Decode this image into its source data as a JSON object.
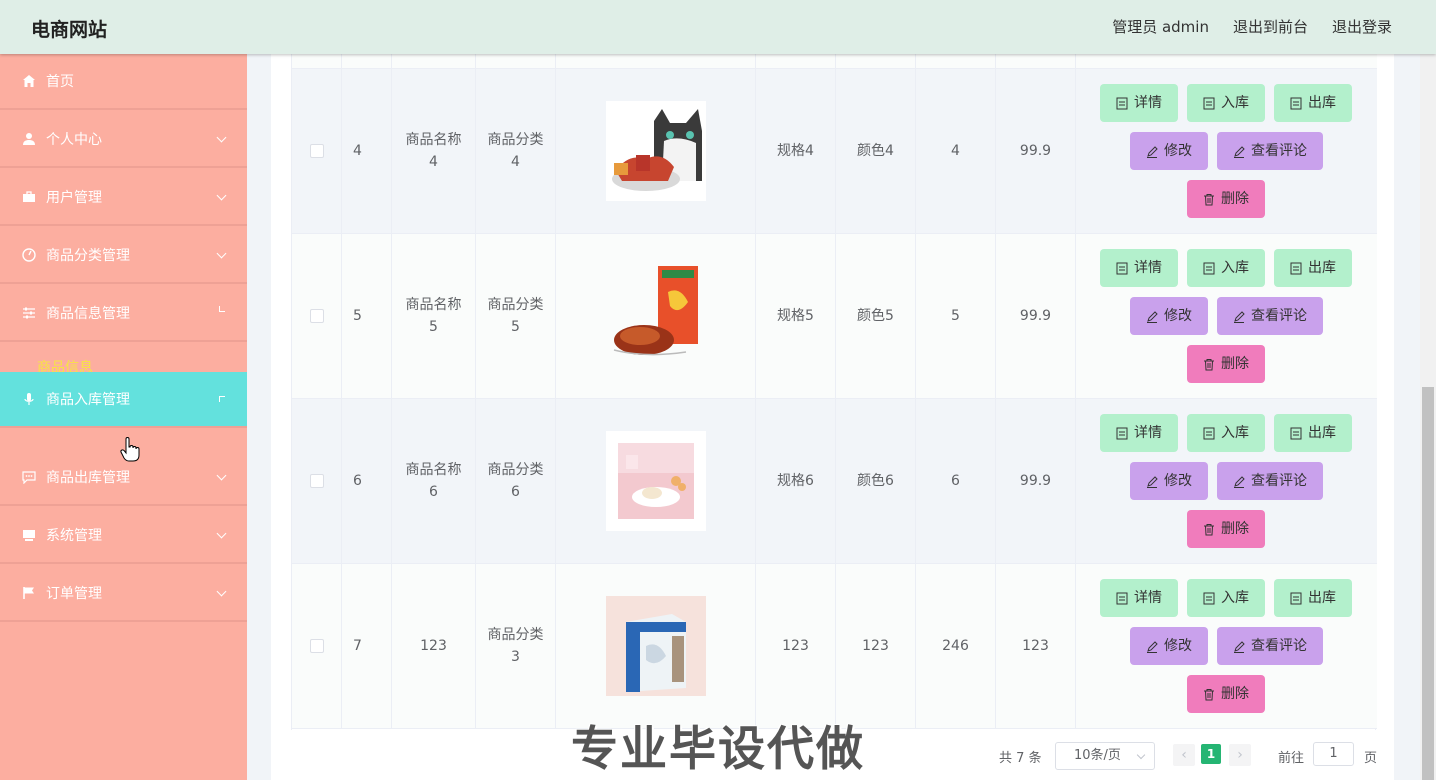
{
  "header": {
    "brand": "电商网站",
    "links": [
      "管理员 admin",
      "退出到前台",
      "退出登录"
    ]
  },
  "sidebar": {
    "items": [
      {
        "label": "首页",
        "icon": "home-icon"
      },
      {
        "label": "个人中心",
        "icon": "user-icon"
      },
      {
        "label": "用户管理",
        "icon": "briefcase-icon"
      },
      {
        "label": "商品分类管理",
        "icon": "gauge-icon"
      },
      {
        "label": "商品信息管理",
        "icon": "sliders-icon"
      },
      {
        "label": "商品入库管理",
        "icon": "mic-icon"
      },
      {
        "label": "商品出库管理",
        "icon": "chat-icon"
      },
      {
        "label": "系统管理",
        "icon": "monitor-icon"
      },
      {
        "label": "订单管理",
        "icon": "flag-icon"
      }
    ],
    "submenu_label": "商品信息"
  },
  "table": {
    "rows": [
      {
        "index": "4",
        "name": "商品名称4",
        "category": "商品分类4",
        "spec": "规格4",
        "color": "颜色4",
        "stock": "4",
        "price": "99.9",
        "image": "snack-cat-image"
      },
      {
        "index": "5",
        "name": "商品名称5",
        "category": "商品分类5",
        "spec": "规格5",
        "color": "颜色5",
        "stock": "5",
        "price": "99.9",
        "image": "roast-duck-image"
      },
      {
        "index": "6",
        "name": "商品名称6",
        "category": "商品分类6",
        "spec": "规格6",
        "color": "颜色6",
        "stock": "6",
        "price": "99.9",
        "image": "pink-dessert-image"
      },
      {
        "index": "7",
        "name": "123",
        "category": "商品分类3",
        "spec": "123",
        "color": "123",
        "stock": "246",
        "price": "123",
        "image": "medicine-box-image"
      }
    ],
    "actions": {
      "detail": "详情",
      "stock_in": "入库",
      "stock_out": "出库",
      "edit": "修改",
      "comments": "查看评论",
      "delete": "删除"
    }
  },
  "pagination": {
    "total": "共 7 条",
    "page_size": "10条/页",
    "current": "1",
    "goto_label": "前往",
    "goto_value": "1",
    "page_unit": "页"
  },
  "watermark": "专业毕设代做",
  "colors": {
    "topbar": "#dfeee7",
    "sidebar": "#fcaea0",
    "sidebar_active": "#63e1dd",
    "btn_green": "#b3f0cc",
    "btn_purple": "#c9a1ec",
    "btn_pink": "#f07cbc",
    "pager_active": "#25b573"
  }
}
